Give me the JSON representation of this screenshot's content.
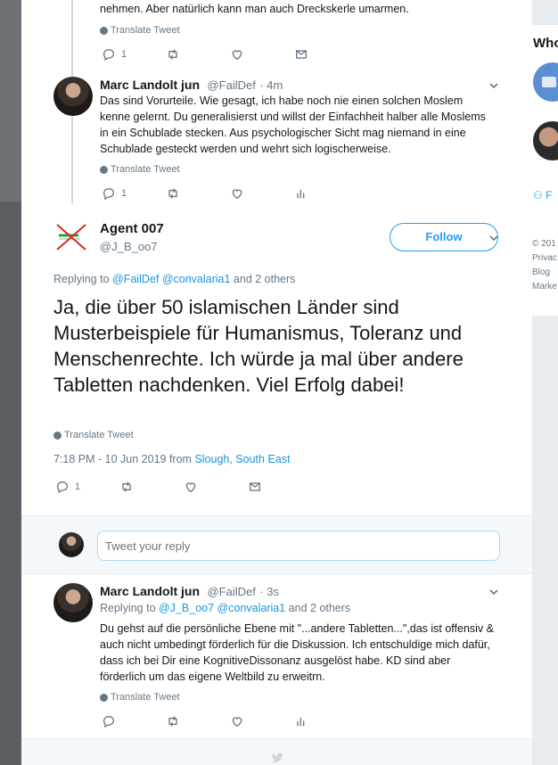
{
  "top_reply": {
    "text_tail": "nehmen. Aber natürlich kann man auch Dreckskerle umarmen.",
    "translate": "Translate Tweet",
    "reply_count": "1"
  },
  "reply1": {
    "name": "Marc Landolt jun",
    "handle": "@FailDef",
    "time": "· 4m",
    "text": "Das sind Vorurteile. Wie gesagt, ich habe noch nie einen solchen Moslem kenne gelernt. Du generalisierst und willst der Einfachheit halber alle Moslems in ein Schublade stecken. Aus psychologischer Sicht mag niemand in eine Schublade gesteckt werden und wehrt sich logischerweise.",
    "translate": "Translate Tweet",
    "reply_count": "1"
  },
  "main_tweet": {
    "name": "Agent 007",
    "handle": "@J_B_oo7",
    "follow_label": "Follow",
    "replying_prefix": "Replying to",
    "replying_user1": "@FailDef",
    "replying_user2": "@convalaria1",
    "replying_suffix": "and 2 others",
    "text": "Ja, die über 50 islamischen Länder sind Musterbeispiele für Humanismus, Toleranz und Menschenrechte. Ich würde ja mal über andere Tabletten nachdenken. Viel Erfolg dabei!",
    "translate": "Translate Tweet",
    "timestamp": "7:18 PM - 10 Jun 2019 from",
    "location": "Slough, South East",
    "reply_count": "1"
  },
  "composer": {
    "placeholder": "Tweet your reply"
  },
  "reply2": {
    "name": "Marc Landolt jun",
    "handle": "@FailDef",
    "time": "· 3s",
    "replying_prefix": "Replying to",
    "replying_user1": "@J_B_oo7",
    "replying_user2": "@convalaria1",
    "replying_suffix": "and 2 others",
    "text": "Du gehst auf die persönliche Ebene mit \"...andere Tabletten...\",das ist offensiv & auch nicht umbedingt förderlich für die Diskussion. Ich entschuldige mich dafür, dass ich bei Dir eine KognitiveDissonanz ausgelöst habe. KD sind aber förderlich um das eigene Weltbild zu erweitrn.",
    "translate": "Translate Tweet"
  },
  "right_panel": {
    "title": "Who",
    "link": "F",
    "footer1": "© 201",
    "footer2": "Privac",
    "footer3": "Blog",
    "footer4": "Marke"
  },
  "colors": {
    "accent": "#1da1f2",
    "link": "#1b95e0",
    "muted": "#657786",
    "border": "#e6ecf0"
  }
}
